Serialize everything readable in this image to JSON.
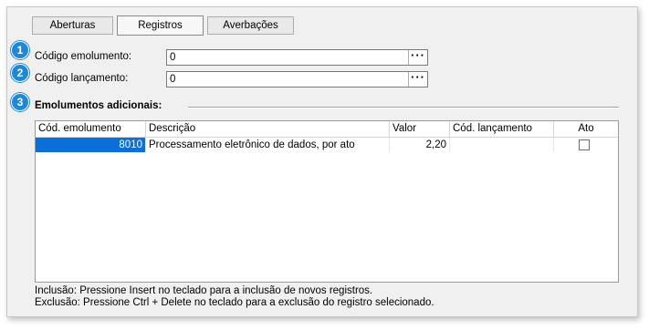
{
  "tabs": [
    {
      "label": "Aberturas",
      "active": false
    },
    {
      "label": "Registros",
      "active": true
    },
    {
      "label": "Averbações",
      "active": false
    }
  ],
  "steps": [
    "1",
    "2",
    "3"
  ],
  "fields": {
    "codigo_emolumento": {
      "label": "Código emolumento:",
      "value": "0",
      "button": "···"
    },
    "codigo_lancamento": {
      "label": "Código lançamento:",
      "value": "0",
      "button": "···"
    }
  },
  "section": {
    "title": "Emolumentos adicionais:"
  },
  "grid": {
    "columns": [
      "Cód. emolumento",
      "Descrição",
      "Valor",
      "Cód. lançamento",
      "Ato"
    ],
    "rows": [
      {
        "cod_emolumento": "8010",
        "descricao": "Processamento eletrônico de dados, por ato",
        "valor": "2,20",
        "cod_lancamento": "",
        "ato": false
      }
    ]
  },
  "help": {
    "inclusao": "Inclusão: Pressione Insert no teclado para a inclusão de novos registros.",
    "exclusao": "Exclusão: Pressione Ctrl + Delete no teclado para a exclusão do registro selecionado."
  },
  "colors": {
    "selection": "#0a6fd6",
    "badge": "#1e88d6",
    "panel": "#f0f0f0"
  }
}
